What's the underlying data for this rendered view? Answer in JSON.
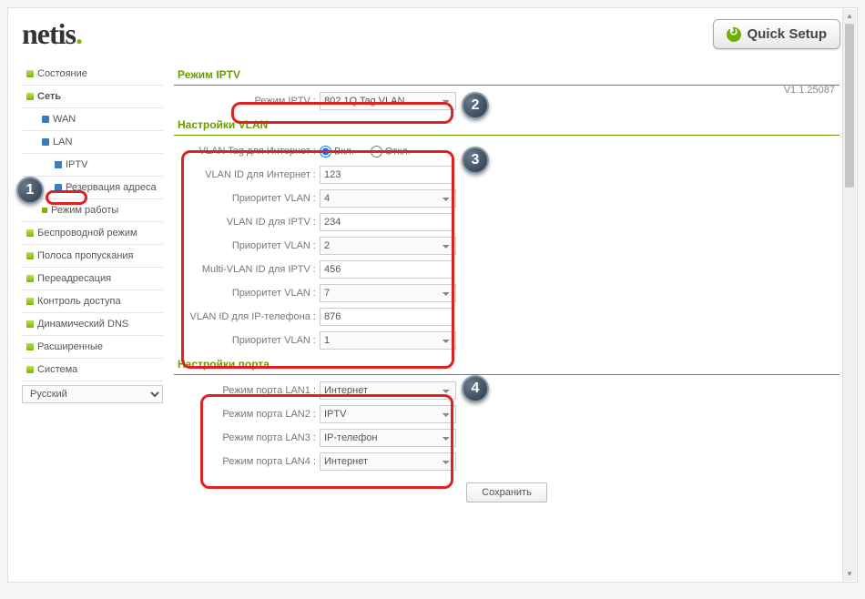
{
  "header": {
    "logo": "netis",
    "quick_setup": "Quick Setup"
  },
  "version": "V1.1.25087",
  "sidebar": {
    "items": [
      {
        "label": "Состояние"
      },
      {
        "label": "Сеть"
      },
      {
        "label": "WAN"
      },
      {
        "label": "LAN"
      },
      {
        "label": "IPTV"
      },
      {
        "label": "Резервация адреса"
      },
      {
        "label": "Режим работы"
      },
      {
        "label": "Беспроводной режим"
      },
      {
        "label": "Полоса пропускания"
      },
      {
        "label": "Переадресация"
      },
      {
        "label": "Контроль доступа"
      },
      {
        "label": "Динамический DNS"
      },
      {
        "label": "Расширенные"
      },
      {
        "label": "Система"
      }
    ],
    "language": "Русский"
  },
  "sections": {
    "iptv_mode": {
      "title": "Режим IPTV",
      "mode_label": "Режим IPTV",
      "mode_value": "802.1Q Tag VLAN"
    },
    "vlan": {
      "title": "Настройки VLAN",
      "tag_label": "VLAN Tag для Интернет",
      "tag_on": "Вкл.",
      "tag_off": "Откл.",
      "id_internet_label": "VLAN ID для Интернет",
      "id_internet_value": "123",
      "prio_label": "Приоритет VLAN",
      "prio_internet": "4",
      "id_iptv_label": "VLAN ID для IPTV",
      "id_iptv_value": "234",
      "prio_iptv": "2",
      "multi_id_label": "Multi-VLAN ID для IPTV",
      "multi_id_value": "456",
      "prio_multi": "7",
      "id_phone_label": "VLAN ID для IP-телефона",
      "id_phone_value": "876",
      "prio_phone": "1"
    },
    "port": {
      "title": "Настройки порта",
      "lan1_label": "Режим порта LAN1",
      "lan1_value": "Интернет",
      "lan2_label": "Режим порта LAN2",
      "lan2_value": "IPTV",
      "lan3_label": "Режим порта LAN3",
      "lan3_value": "IP-телефон",
      "lan4_label": "Режим порта LAN4",
      "lan4_value": "Интернет"
    },
    "save": "Сохранить"
  },
  "callouts": {
    "c1": "1",
    "c2": "2",
    "c3": "3",
    "c4": "4"
  }
}
